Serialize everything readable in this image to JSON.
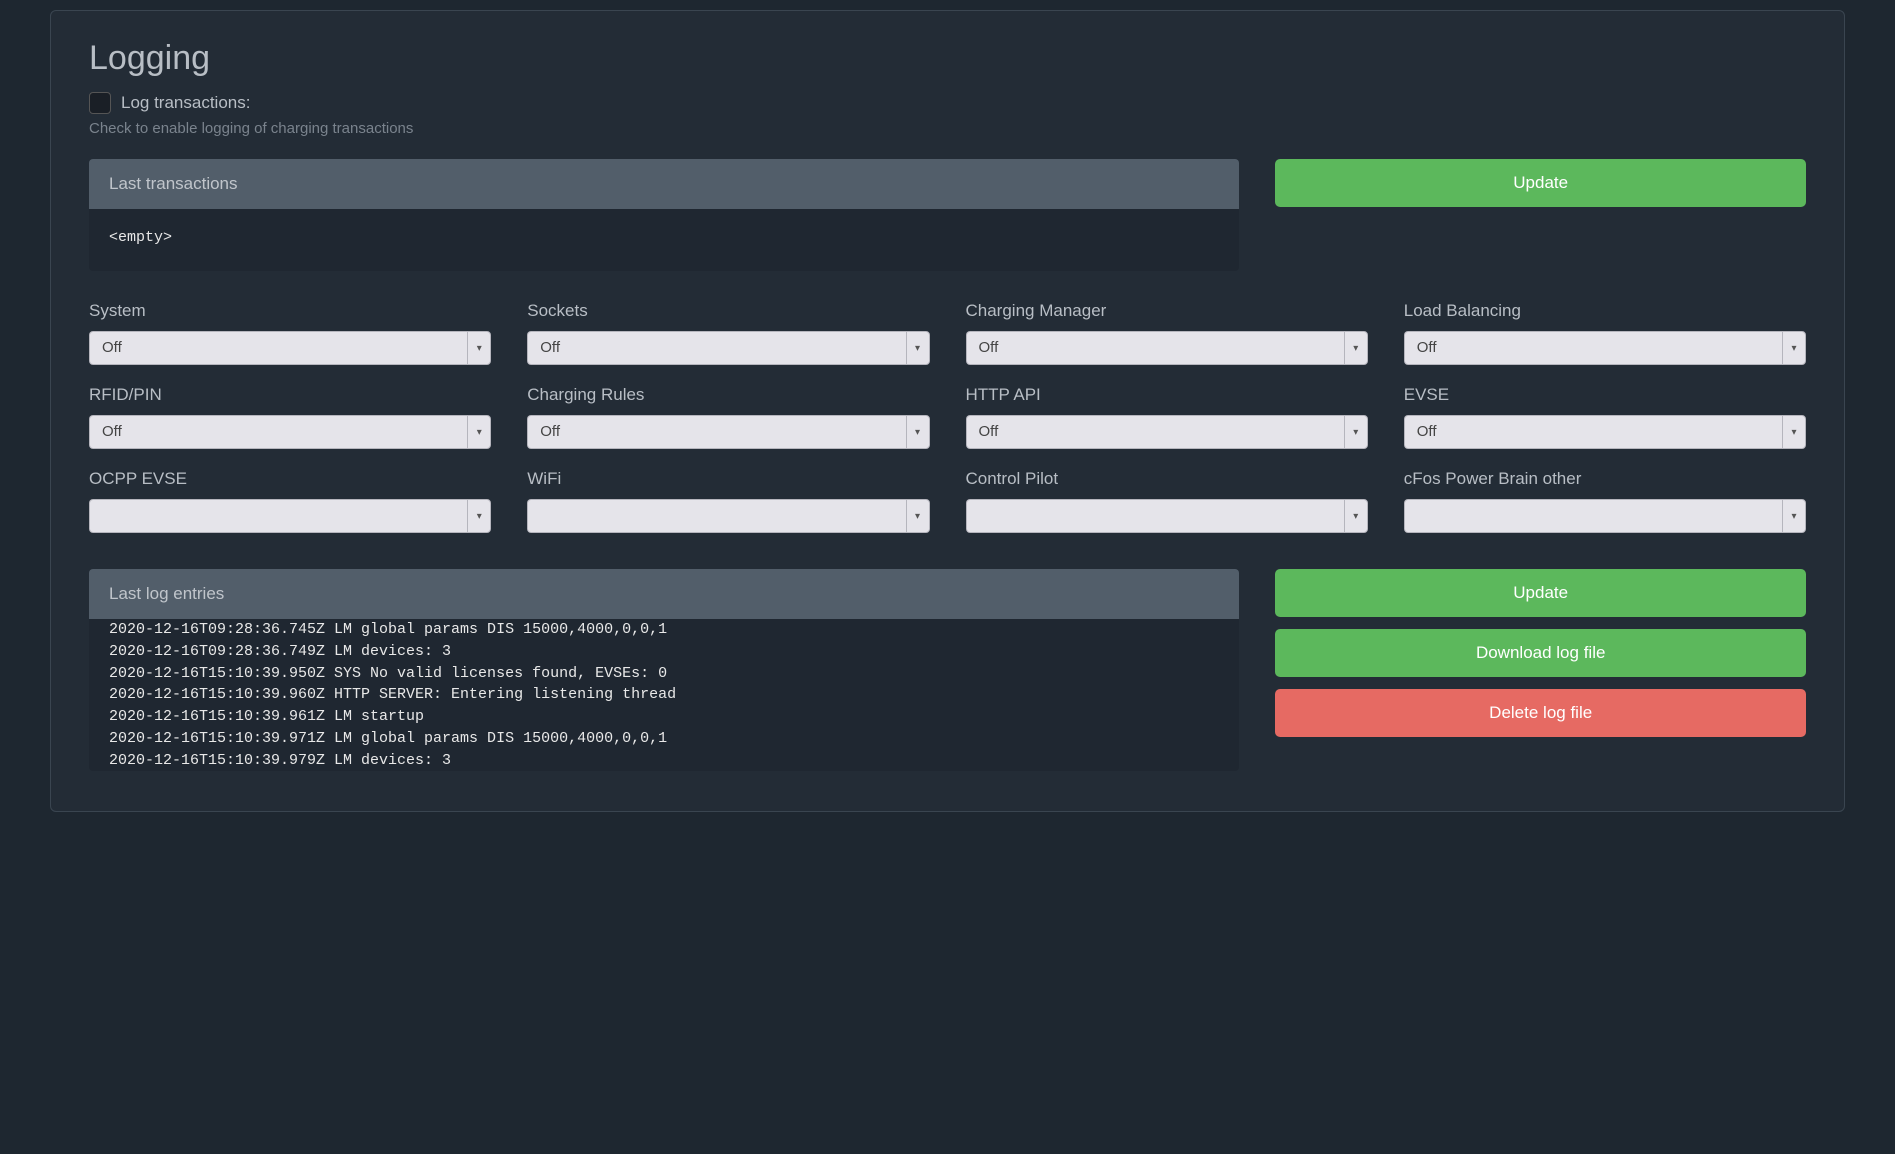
{
  "header": {
    "title": "Logging",
    "checkbox_label": "Log transactions:",
    "help_text": "Check to enable logging of charging transactions"
  },
  "last_transactions": {
    "header": "Last transactions",
    "body": "<empty>"
  },
  "buttons": {
    "update_top": "Update",
    "update_log": "Update",
    "download_log": "Download log file",
    "delete_log": "Delete log file"
  },
  "selects": [
    {
      "label": "System",
      "value": "Off"
    },
    {
      "label": "Sockets",
      "value": "Off"
    },
    {
      "label": "Charging Manager",
      "value": "Off"
    },
    {
      "label": "Load Balancing",
      "value": "Off"
    },
    {
      "label": "RFID/PIN",
      "value": "Off"
    },
    {
      "label": "Charging Rules",
      "value": "Off"
    },
    {
      "label": "HTTP API",
      "value": "Off"
    },
    {
      "label": "EVSE",
      "value": "Off"
    },
    {
      "label": "OCPP EVSE",
      "value": ""
    },
    {
      "label": "WiFi",
      "value": ""
    },
    {
      "label": "Control Pilot",
      "value": ""
    },
    {
      "label": "cFos Power Brain other",
      "value": ""
    }
  ],
  "last_log": {
    "header": "Last log entries",
    "lines": [
      "2020-12-16T09:28:36.745Z LM global params DIS 15000,4000,0,0,1",
      "2020-12-16T09:28:36.749Z LM devices: 3",
      "2020-12-16T15:10:39.950Z SYS No valid licenses found, EVSEs: 0",
      "2020-12-16T15:10:39.960Z HTTP SERVER: Entering listening thread",
      "2020-12-16T15:10:39.961Z LM startup",
      "2020-12-16T15:10:39.971Z LM global params DIS 15000,4000,0,0,1",
      "2020-12-16T15:10:39.979Z LM devices: 3"
    ]
  }
}
